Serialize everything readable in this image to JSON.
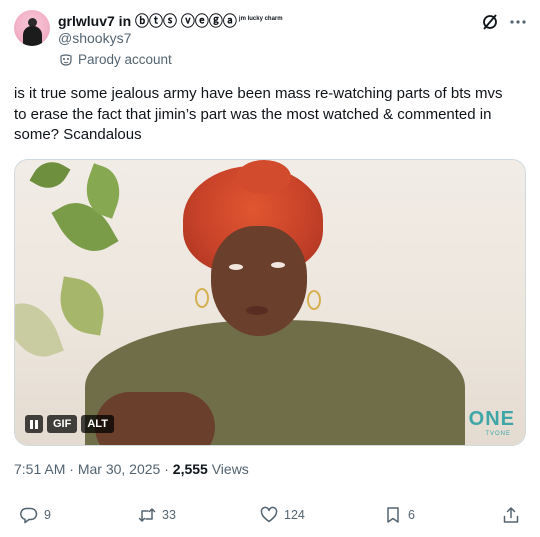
{
  "author": {
    "display_name": "grlwluv7 in ⓑⓣⓢ ⓥⓔⓖⓐ",
    "name_superscript": "jm lucky charm",
    "handle": "@shookys7",
    "label": "Parody account"
  },
  "tweet": {
    "text": "is it true some jealous army have been mass re-watching parts of bts mvs to erase the fact that jimin’s part was the most watched & commented in some? Scandalous"
  },
  "media": {
    "pause_icon": "pause-icon",
    "gif_label": "GIF",
    "alt_label": "ALT",
    "watermark": "ONE",
    "watermark_sub": "TVONE"
  },
  "meta": {
    "time": "7:51 AM",
    "separator": "·",
    "date": "Mar 30, 2025",
    "views_count": "2,555",
    "views_label": "Views"
  },
  "actions": {
    "replies": "9",
    "reposts": "33",
    "likes": "124",
    "bookmarks": "6"
  },
  "colors": {
    "text_primary": "#0f1419",
    "text_secondary": "#536471",
    "border": "#cfd9de"
  },
  "icons": [
    "grok-icon",
    "more-icon",
    "parody-mask-icon",
    "reply-icon",
    "repost-icon",
    "like-icon",
    "bookmark-icon",
    "share-icon"
  ]
}
